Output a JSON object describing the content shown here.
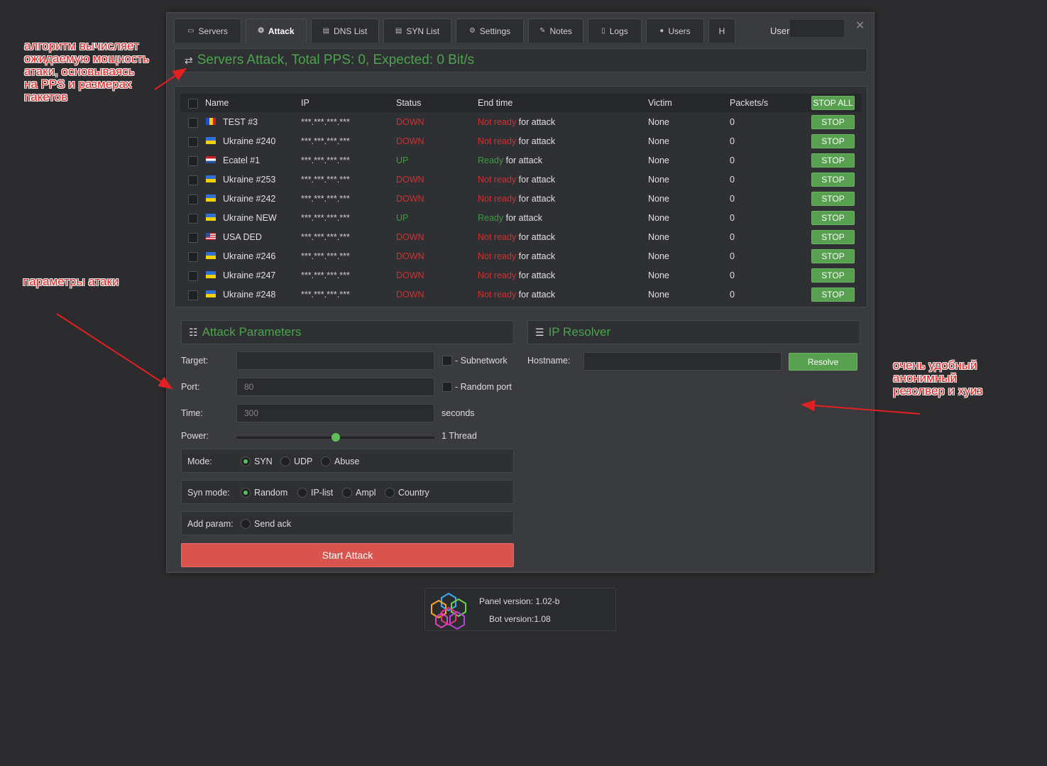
{
  "tabs": [
    {
      "label": "Servers",
      "icon": "server-icon",
      "active": false
    },
    {
      "label": "Attack",
      "icon": "palette-icon",
      "active": true
    },
    {
      "label": "DNS List",
      "icon": "list-icon",
      "active": false
    },
    {
      "label": "SYN List",
      "icon": "list-icon",
      "active": false
    },
    {
      "label": "Settings",
      "icon": "cogs-icon",
      "active": false
    },
    {
      "label": "Notes",
      "icon": "edit-icon",
      "active": false
    },
    {
      "label": "Logs",
      "icon": "file-icon",
      "active": false
    },
    {
      "label": "Users",
      "icon": "user-icon",
      "active": false
    },
    {
      "label": "H",
      "icon": "",
      "active": false
    }
  ],
  "user_label": "User",
  "header_title": "Servers Attack, Total PPS: 0, Expected: 0 Bit/s",
  "table": {
    "columns": {
      "name": "Name",
      "ip": "IP",
      "status": "Status",
      "end": "End time",
      "victim": "Victim",
      "pps": "Packets/s"
    },
    "stop_all": "STOP ALL",
    "rows": [
      {
        "name": "TEST #3",
        "flag": "romania",
        "ip": "***.***.***.***",
        "status": "DOWN",
        "ready": "Not ready",
        "suffix": " for attack",
        "victim": "None",
        "pps": "0",
        "stop": "STOP"
      },
      {
        "name": "Ukraine #240",
        "flag": "ukraine",
        "ip": "***.***.***.***",
        "status": "DOWN",
        "ready": "Not ready",
        "suffix": " for attack",
        "victim": "None",
        "pps": "0",
        "stop": "STOP"
      },
      {
        "name": "Ecatel #1",
        "flag": "netherlands",
        "ip": "***.***.***.***",
        "status": "UP",
        "ready": "Ready",
        "suffix": " for attack",
        "victim": "None",
        "pps": "0",
        "stop": "STOP"
      },
      {
        "name": "Ukraine #253",
        "flag": "ukraine",
        "ip": "***.***.***.***",
        "status": "DOWN",
        "ready": "Not ready",
        "suffix": " for attack",
        "victim": "None",
        "pps": "0",
        "stop": "STOP"
      },
      {
        "name": "Ukraine #242",
        "flag": "ukraine",
        "ip": "***.***.***.***",
        "status": "DOWN",
        "ready": "Not ready",
        "suffix": " for attack",
        "victim": "None",
        "pps": "0",
        "stop": "STOP"
      },
      {
        "name": "Ukraine NEW",
        "flag": "ukraine",
        "ip": "***.***.***.***",
        "status": "UP",
        "ready": "Ready",
        "suffix": " for attack",
        "victim": "None",
        "pps": "0",
        "stop": "STOP"
      },
      {
        "name": "USA DED",
        "flag": "usa",
        "ip": "***.***.***.***",
        "status": "DOWN",
        "ready": "Not ready",
        "suffix": " for attack",
        "victim": "None",
        "pps": "0",
        "stop": "STOP"
      },
      {
        "name": "Ukraine #246",
        "flag": "ukraine",
        "ip": "***.***.***.***",
        "status": "DOWN",
        "ready": "Not ready",
        "suffix": " for attack",
        "victim": "None",
        "pps": "0",
        "stop": "STOP"
      },
      {
        "name": "Ukraine #247",
        "flag": "ukraine",
        "ip": "***.***.***.***",
        "status": "DOWN",
        "ready": "Not ready",
        "suffix": " for attack",
        "victim": "None",
        "pps": "0",
        "stop": "STOP"
      },
      {
        "name": "Ukraine #248",
        "flag": "ukraine",
        "ip": "***.***.***.***",
        "status": "DOWN",
        "ready": "Not ready",
        "suffix": " for attack",
        "victim": "None",
        "pps": "0",
        "stop": "STOP"
      }
    ]
  },
  "attack": {
    "title": "Attack Parameters",
    "target_label": "Target:",
    "target_value": "",
    "subnetwork_label": "- Subnetwork",
    "port_label": "Port:",
    "port_placeholder": "80",
    "random_port_label": "- Random port",
    "time_label": "Time:",
    "time_placeholder": "300",
    "seconds_label": "seconds",
    "power_label": "Power:",
    "power_value": "1 Thread",
    "power_level": 0.5,
    "mode_label": "Mode:",
    "modes": [
      {
        "label": "SYN",
        "on": true
      },
      {
        "label": "UDP",
        "on": false
      },
      {
        "label": "Abuse",
        "on": false
      }
    ],
    "syn_mode_label": "Syn mode:",
    "syn_modes": [
      {
        "label": "Random",
        "on": true
      },
      {
        "label": "IP-list",
        "on": false
      },
      {
        "label": "Ampl",
        "on": false
      },
      {
        "label": "Country",
        "on": false
      }
    ],
    "add_param_label": "Add param:",
    "send_ack_label": "Send ack",
    "start_label": "Start Attack"
  },
  "resolver": {
    "title": "IP Resolver",
    "hostname_label": "Hostname:",
    "hostname_value": "",
    "resolve_label": "Resolve"
  },
  "footer": {
    "panel_version": "Panel version: 1.02-b",
    "bot_version": "Bot version:1.08"
  },
  "annotations": {
    "top_left": "алгоритм вычисляет\nожидаемую мощность\nатаки, основываясь\nна PPS и размерах\nпакетов",
    "middle_left": "параметры атаки",
    "right": "очень удобный\nанонимный\nрезолвер и хуиз"
  },
  "colors": {
    "accent_green": "#4da34d",
    "button_green": "#56a04f",
    "status_red": "#d03030",
    "start_red": "#d9534f",
    "annotation_red": "#e32020"
  }
}
